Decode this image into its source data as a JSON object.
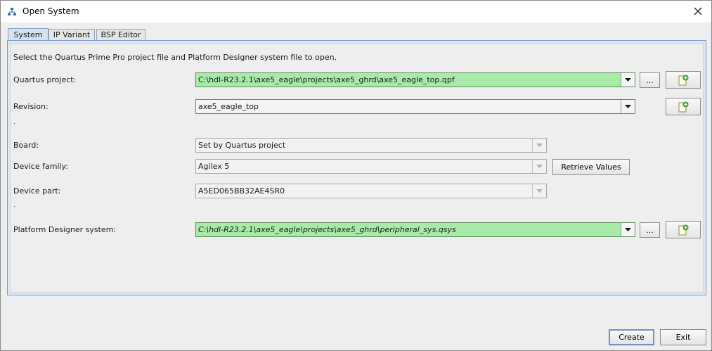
{
  "window": {
    "title": "Open System"
  },
  "tabs": [
    {
      "label": "System",
      "active": true
    },
    {
      "label": "IP Variant",
      "active": false
    },
    {
      "label": "BSP Editor",
      "active": false
    }
  ],
  "instructions": "Select the Quartus Prime Pro project file and Platform Designer system file to open.",
  "quartus_project": {
    "label": "Quartus project:",
    "value": "C:\\hdl-R23.2.1\\axe5_eagle\\projects\\axe5_ghrd\\axe5_eagle_top.qpf",
    "browse_label": "..."
  },
  "revision": {
    "label": "Revision:",
    "value": "axe5_eagle_top"
  },
  "board": {
    "label": "Board:",
    "value": "Set by Quartus project"
  },
  "device_family": {
    "label": "Device family:",
    "value": "Agilex 5",
    "retrieve_label": "Retrieve Values"
  },
  "device_part": {
    "label": "Device part:",
    "value": "A5ED065BB32AE4SR0"
  },
  "platform_designer": {
    "label": "Platform Designer system:",
    "value": "C:\\hdl-R23.2.1\\axe5_eagle\\projects\\axe5_ghrd\\peripheral_sys.qsys",
    "browse_label": "..."
  },
  "footer": {
    "create_label": "Create",
    "exit_label": "Exit"
  },
  "colors": {
    "valid_field": "#a8eba8",
    "tab_active": "#d5e3f2",
    "panel_border": "#7b9cc4"
  },
  "icons": {
    "app": "hierarchy-icon",
    "close": "close-icon",
    "new_file": "new-file-plus-icon",
    "dropdown": "chevron-down-icon"
  }
}
